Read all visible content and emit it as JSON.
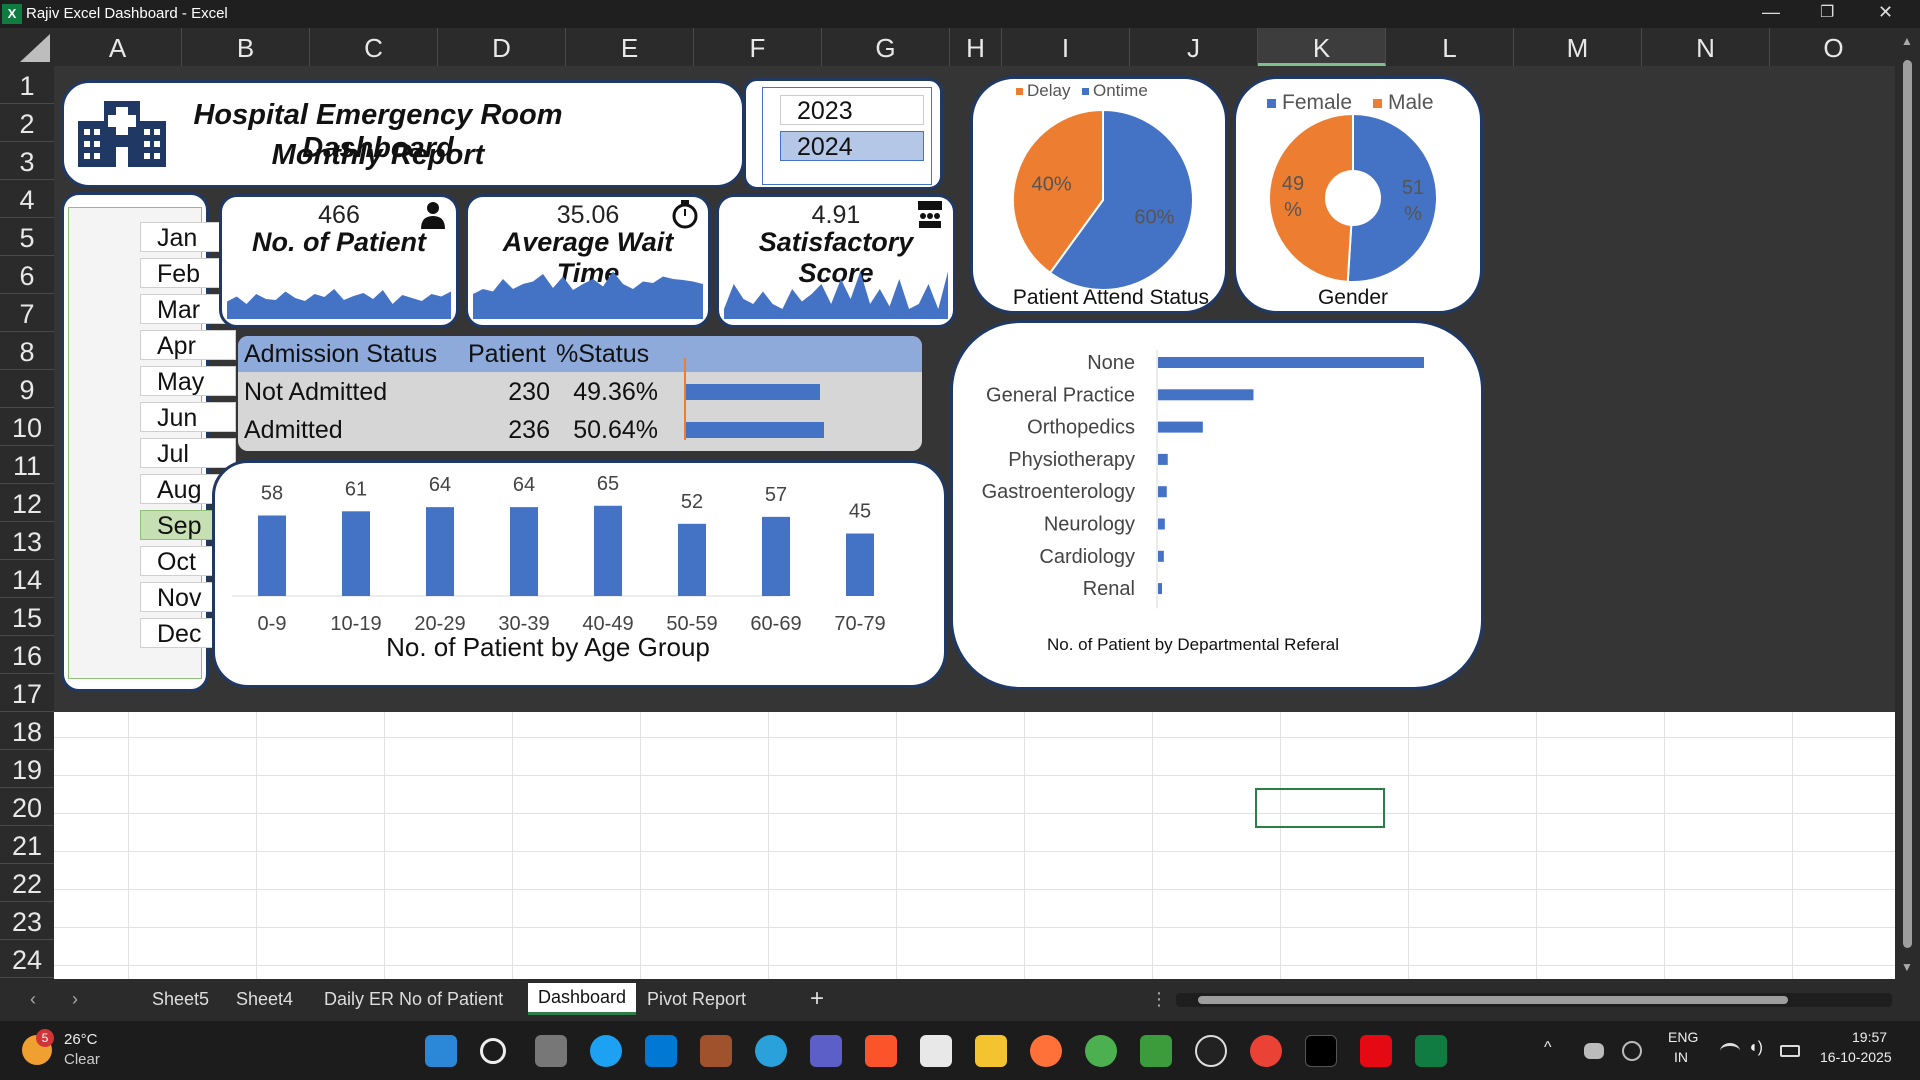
{
  "window": {
    "title": "Rajiv Excel Dashboard - Excel"
  },
  "columns": [
    "A",
    "B",
    "C",
    "D",
    "E",
    "F",
    "G",
    "H",
    "I",
    "J",
    "K",
    "L",
    "M",
    "N",
    "O"
  ],
  "rows": [
    "1",
    "2",
    "3",
    "4",
    "5",
    "6",
    "7",
    "8",
    "9",
    "10",
    "11",
    "12",
    "13",
    "14",
    "15",
    "16",
    "17",
    "18",
    "19",
    "20",
    "21",
    "22",
    "23",
    "24"
  ],
  "dashboard": {
    "title_line1": "Hospital Emergency Room Dashboard",
    "title_line2": "Monthly Report",
    "years": [
      "2023",
      "2024"
    ],
    "selected_year": "2024",
    "months": [
      "Jan",
      "Feb",
      "Mar",
      "Apr",
      "May",
      "Jun",
      "Jul",
      "Aug",
      "Sep",
      "Oct",
      "Nov",
      "Dec"
    ],
    "selected_month": "Sep",
    "kpis": [
      {
        "value": "466",
        "label": "No. of Patient",
        "icon": "patient-icon"
      },
      {
        "value": "35.06",
        "label": "Average Wait Time",
        "icon": "stopwatch-icon"
      },
      {
        "value": "4.91",
        "label": "Satisfactory Score",
        "icon": "audience-icon"
      }
    ],
    "admission": {
      "headers": [
        "Admission Status",
        "Patient",
        "%Status"
      ],
      "rows": [
        {
          "status": "Not Admitted",
          "patient": "230",
          "pct": "49.36%",
          "ratio": 0.4936
        },
        {
          "status": "Admitted",
          "patient": "236",
          "pct": "50.64%",
          "ratio": 0.5064
        }
      ]
    },
    "colors": {
      "blue": "#4472c4",
      "orange": "#ed7d31",
      "navy": "#1f3864",
      "selected_month": "#c6e0b4",
      "selected_year": "#b4c7e7"
    }
  },
  "chart_data": [
    {
      "type": "pie",
      "title": "Patient Attend Status",
      "legend": [
        "Delay",
        "Ontime"
      ],
      "values": [
        40,
        60
      ],
      "labels": [
        "40%",
        "60%"
      ],
      "colors": [
        "#ed7d31",
        "#4472c4"
      ]
    },
    {
      "type": "pie",
      "title": "Gender",
      "legend": [
        "Female",
        "Male"
      ],
      "values": [
        51,
        49
      ],
      "labels": [
        "51 %",
        "49 %"
      ],
      "colors": [
        "#4472c4",
        "#ed7d31"
      ]
    },
    {
      "type": "bar",
      "title": "No. of Patient by Age Group",
      "categories": [
        "0-9",
        "10-19",
        "20-29",
        "30-39",
        "40-49",
        "50-59",
        "60-69",
        "70-79"
      ],
      "values": [
        58,
        61,
        64,
        64,
        65,
        52,
        57,
        45
      ]
    },
    {
      "type": "bar",
      "orientation": "horizontal",
      "title": "No. of Patient by Departmental Referal",
      "categories": [
        "None",
        "General Practice",
        "Orthopedics",
        "Physiotherapy",
        "Gastroenterology",
        "Neurology",
        "Cardiology",
        "Renal"
      ],
      "values": [
        273,
        98,
        46,
        10,
        9,
        7,
        6,
        4
      ]
    }
  ],
  "sheet_tabs": [
    "Sheet5",
    "Sheet4",
    "Daily ER No of Patient",
    "Dashboard",
    "Pivot Report"
  ],
  "active_tab": "Dashboard",
  "taskbar": {
    "badge": "5",
    "temp": "26°C",
    "weather": "Clear",
    "lang1": "ENG",
    "lang2": "IN",
    "time": "19:57",
    "date": "16-10-2025"
  }
}
